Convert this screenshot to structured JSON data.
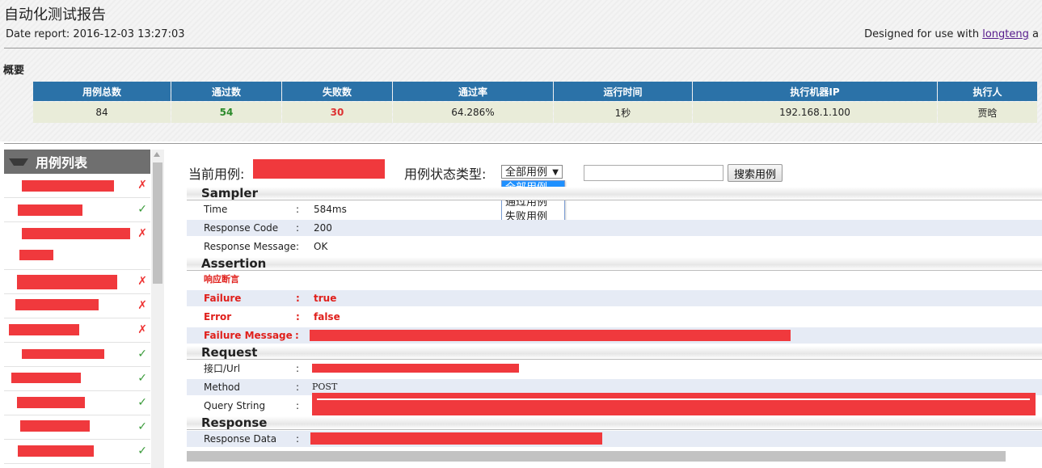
{
  "header": {
    "title": "自动化测试报告",
    "date_report": "Date report: 2016-12-03 13:27:03",
    "designed_prefix": "Designed for use with ",
    "designed_link": "longteng",
    "designed_suffix": " a"
  },
  "summary": {
    "label": "概要",
    "columns": [
      "用例总数",
      "通过数",
      "失败数",
      "通过率",
      "运行时间",
      "执行机器IP",
      "执行人"
    ],
    "values": {
      "total": "84",
      "passed": "54",
      "failed": "30",
      "pass_rate": "64.286%",
      "run_time": "1秒",
      "machine_ip": "192.168.1.100",
      "executor": "贾晗"
    }
  },
  "case_list": {
    "title": "用例列表",
    "items": [
      {
        "status": "fail",
        "mark": "✗"
      },
      {
        "status": "pass",
        "mark": "✓"
      },
      {
        "status": "fail",
        "mark": "✗"
      },
      {
        "status": "fail",
        "mark": "✗"
      },
      {
        "status": "fail",
        "mark": "✗"
      },
      {
        "status": "fail",
        "mark": "✗"
      },
      {
        "status": "pass",
        "mark": "✓"
      },
      {
        "status": "pass",
        "mark": "✓"
      },
      {
        "status": "pass",
        "mark": "✓"
      },
      {
        "status": "pass",
        "mark": "✓"
      },
      {
        "status": "pass",
        "mark": "✓"
      }
    ]
  },
  "toolbar": {
    "current_case_label": "当前用例:",
    "status_type_label": "用例状态类型:",
    "selected_option": "全部用例",
    "options": [
      "全部用例",
      "通过用例",
      "失败用例"
    ],
    "search_button": "搜索用例",
    "search_value": ""
  },
  "sampler": {
    "title": "Sampler",
    "time_label": "Time",
    "time_value": "584ms",
    "code_label": "Response Code",
    "code_value": "200",
    "message_label": "Response Message",
    "message_value": "OK"
  },
  "assertion": {
    "title": "Assertion",
    "subtitle": "响应断言",
    "failure_label": "Failure",
    "failure_value": "true",
    "error_label": "Error",
    "error_value": "false",
    "failure_message_label": "Failure Message"
  },
  "request": {
    "title": "Request",
    "url_label": "接口/Url",
    "method_label": "Method",
    "method_value": "POST",
    "query_label": "Query String"
  },
  "response": {
    "title": "Response",
    "data_label": "Response Data"
  },
  "separator": ":",
  "colors": {
    "table_header": "#2b72a8",
    "table_row": "#e9ecd9",
    "pass": "#2b8a2b",
    "fail": "#d33333",
    "redaction": "#f0393d",
    "alt_row": "#e6ebf5"
  }
}
